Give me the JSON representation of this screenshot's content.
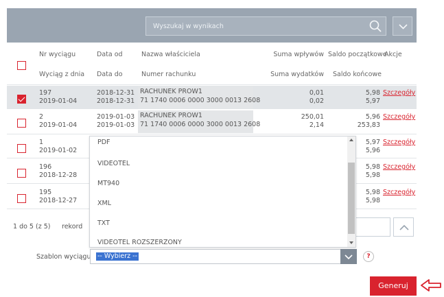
{
  "search": {
    "placeholder": "Wyszukaj w wynikach"
  },
  "header": {
    "col1_top": "Nr wyciągu",
    "col1_bottom": "Wyciąg z dnia",
    "col2_top": "Data od",
    "col2_bottom": "Data do",
    "col3_top": "Nazwa właściciela",
    "col3_bottom": "Numer rachunku",
    "col4_top": "Suma wpływów",
    "col4_bottom": "Suma wydatków",
    "col5_top": "Saldo początkowe",
    "col5_bottom": "Saldo końcowe",
    "col6": "Akcje"
  },
  "rows": [
    {
      "nr": "197",
      "date": "2019-01-04",
      "from": "2018-12-31",
      "to": "2018-12-31",
      "owner": "RACHUNEK PROW1",
      "account": "71 1740 0006 0000 3000 0013 2608",
      "in": "0,01",
      "out": "0,02",
      "saldo_start": "5,98",
      "saldo_end": "5,97",
      "action": "Szczegóły",
      "checked": true
    },
    {
      "nr": "2",
      "date": "2019-01-04",
      "from": "2019-01-03",
      "to": "2019-01-03",
      "owner": "RACHUNEK PROW1",
      "account": "71 1740 0006 0000 3000 0013 2608",
      "in": "250,01",
      "out": "2,14",
      "saldo_start": "5,96",
      "saldo_end": "253,83",
      "action": "Szczegóły",
      "checked": false
    },
    {
      "nr": "1",
      "date": "2019-01-02",
      "saldo_start": "5,97",
      "saldo_end": "5,96",
      "action": "Szczegóły",
      "checked": false
    },
    {
      "nr": "196",
      "date": "2018-12-28",
      "saldo_start": "5,98",
      "saldo_end": "5,98",
      "action": "Szczegóły",
      "checked": false
    },
    {
      "nr": "195",
      "date": "2018-12-27",
      "saldo_start": "5,98",
      "saldo_end": "5,98",
      "action": "Szczegóły",
      "checked": false
    }
  ],
  "pager": {
    "range": "1 do 5 (z 5)",
    "records_label": "rekord"
  },
  "dropdown": {
    "options": [
      "PDF",
      "VIDEOTEL",
      "MT940",
      "XML",
      "TXT",
      "VIDEOTEL ROZSZERZONY"
    ]
  },
  "template": {
    "label": "Szablon wyciągu",
    "selected": "-- Wybierz --"
  },
  "help": "?",
  "generate_label": "Generuj",
  "colors": {
    "accent": "#d9232e",
    "header_bg": "#9aa5b1",
    "select_highlight": "#3b73d1"
  }
}
